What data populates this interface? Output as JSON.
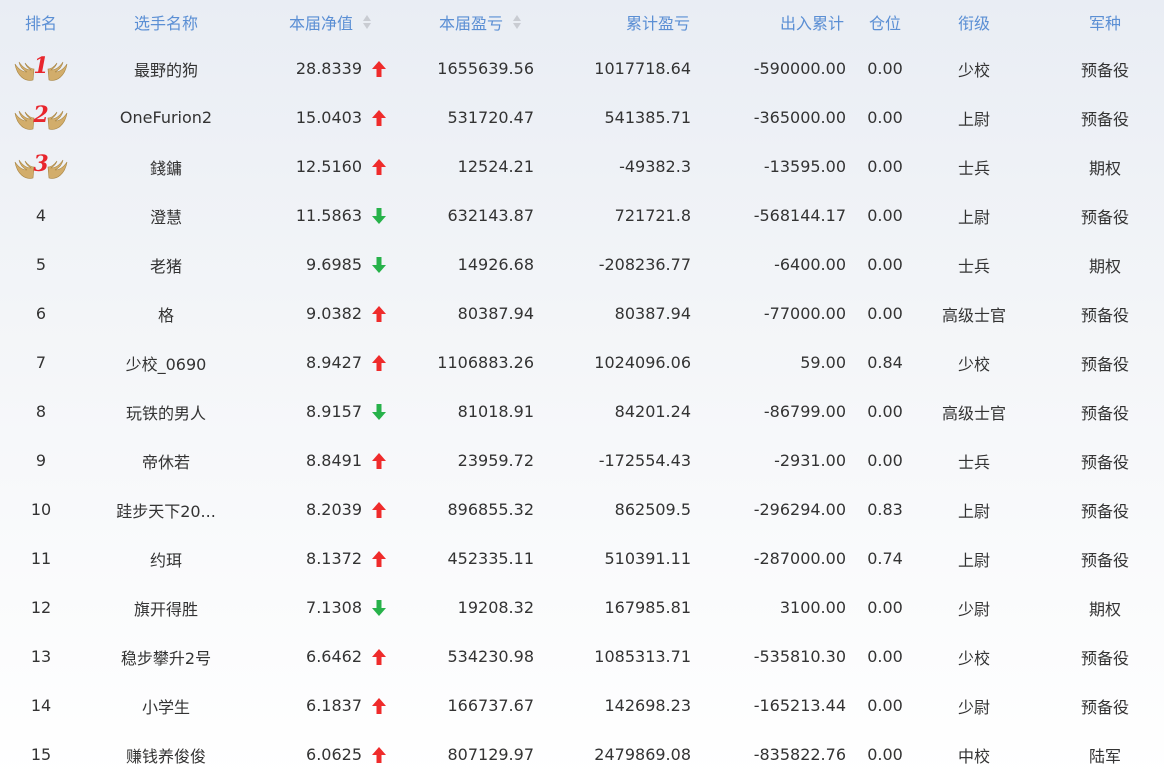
{
  "colors": {
    "header_text": "#5b8fd4",
    "up": "#ef2b2b",
    "down": "#27b24a",
    "medal_num": "#e8262d"
  },
  "header": {
    "rank": "排名",
    "name": "选手名称",
    "nav": "本届净值",
    "cur_pl": "本届盈亏",
    "cum_pl": "累计盈亏",
    "flow": "出入累计",
    "position": "仓位",
    "title": "衔级",
    "arm": "军种"
  },
  "rows": [
    {
      "rank": "1",
      "name": "最野的狗",
      "nav": "28.8339",
      "dir": "up",
      "cur": "1655639.56",
      "cum": "1017718.64",
      "flow": "-590000.00",
      "pos": "0.00",
      "title": "少校",
      "arm": "预备役"
    },
    {
      "rank": "2",
      "name": "OneFurion2",
      "nav": "15.0403",
      "dir": "up",
      "cur": "531720.47",
      "cum": "541385.71",
      "flow": "-365000.00",
      "pos": "0.00",
      "title": "上尉",
      "arm": "预备役"
    },
    {
      "rank": "3",
      "name": "錢鏞",
      "nav": "12.5160",
      "dir": "up",
      "cur": "12524.21",
      "cum": "-49382.3",
      "flow": "-13595.00",
      "pos": "0.00",
      "title": "士兵",
      "arm": "期权"
    },
    {
      "rank": "4",
      "name": "澄慧",
      "nav": "11.5863",
      "dir": "down",
      "cur": "632143.87",
      "cum": "721721.8",
      "flow": "-568144.17",
      "pos": "0.00",
      "title": "上尉",
      "arm": "预备役"
    },
    {
      "rank": "5",
      "name": "老猪",
      "nav": "9.6985",
      "dir": "down",
      "cur": "14926.68",
      "cum": "-208236.77",
      "flow": "-6400.00",
      "pos": "0.00",
      "title": "士兵",
      "arm": "期权"
    },
    {
      "rank": "6",
      "name": "格",
      "nav": "9.0382",
      "dir": "up",
      "cur": "80387.94",
      "cum": "80387.94",
      "flow": "-77000.00",
      "pos": "0.00",
      "title": "高级士官",
      "arm": "预备役"
    },
    {
      "rank": "7",
      "name": "少校_0690",
      "nav": "8.9427",
      "dir": "up",
      "cur": "1106883.26",
      "cum": "1024096.06",
      "flow": "59.00",
      "pos": "0.84",
      "title": "少校",
      "arm": "预备役"
    },
    {
      "rank": "8",
      "name": "玩铁的男人",
      "nav": "8.9157",
      "dir": "down",
      "cur": "81018.91",
      "cum": "84201.24",
      "flow": "-86799.00",
      "pos": "0.00",
      "title": "高级士官",
      "arm": "预备役"
    },
    {
      "rank": "9",
      "name": "帝休若",
      "nav": "8.8491",
      "dir": "up",
      "cur": "23959.72",
      "cum": "-172554.43",
      "flow": "-2931.00",
      "pos": "0.00",
      "title": "士兵",
      "arm": "预备役"
    },
    {
      "rank": "10",
      "name": "跬步天下20...",
      "nav": "8.2039",
      "dir": "up",
      "cur": "896855.32",
      "cum": "862509.5",
      "flow": "-296294.00",
      "pos": "0.83",
      "title": "上尉",
      "arm": "预备役"
    },
    {
      "rank": "11",
      "name": "约珥",
      "nav": "8.1372",
      "dir": "up",
      "cur": "452335.11",
      "cum": "510391.11",
      "flow": "-287000.00",
      "pos": "0.74",
      "title": "上尉",
      "arm": "预备役"
    },
    {
      "rank": "12",
      "name": "旗开得胜",
      "nav": "7.1308",
      "dir": "down",
      "cur": "19208.32",
      "cum": "167985.81",
      "flow": "3100.00",
      "pos": "0.00",
      "title": "少尉",
      "arm": "期权"
    },
    {
      "rank": "13",
      "name": "稳步攀升2号",
      "nav": "6.6462",
      "dir": "up",
      "cur": "534230.98",
      "cum": "1085313.71",
      "flow": "-535810.30",
      "pos": "0.00",
      "title": "少校",
      "arm": "预备役"
    },
    {
      "rank": "14",
      "name": "小学生",
      "nav": "6.1837",
      "dir": "up",
      "cur": "166737.67",
      "cum": "142698.23",
      "flow": "-165213.44",
      "pos": "0.00",
      "title": "少尉",
      "arm": "预备役"
    },
    {
      "rank": "15",
      "name": "赚钱养俊俊",
      "nav": "6.0625",
      "dir": "up",
      "cur": "807129.97",
      "cum": "2479869.08",
      "flow": "-835822.76",
      "pos": "0.00",
      "title": "中校",
      "arm": "陆军"
    }
  ]
}
